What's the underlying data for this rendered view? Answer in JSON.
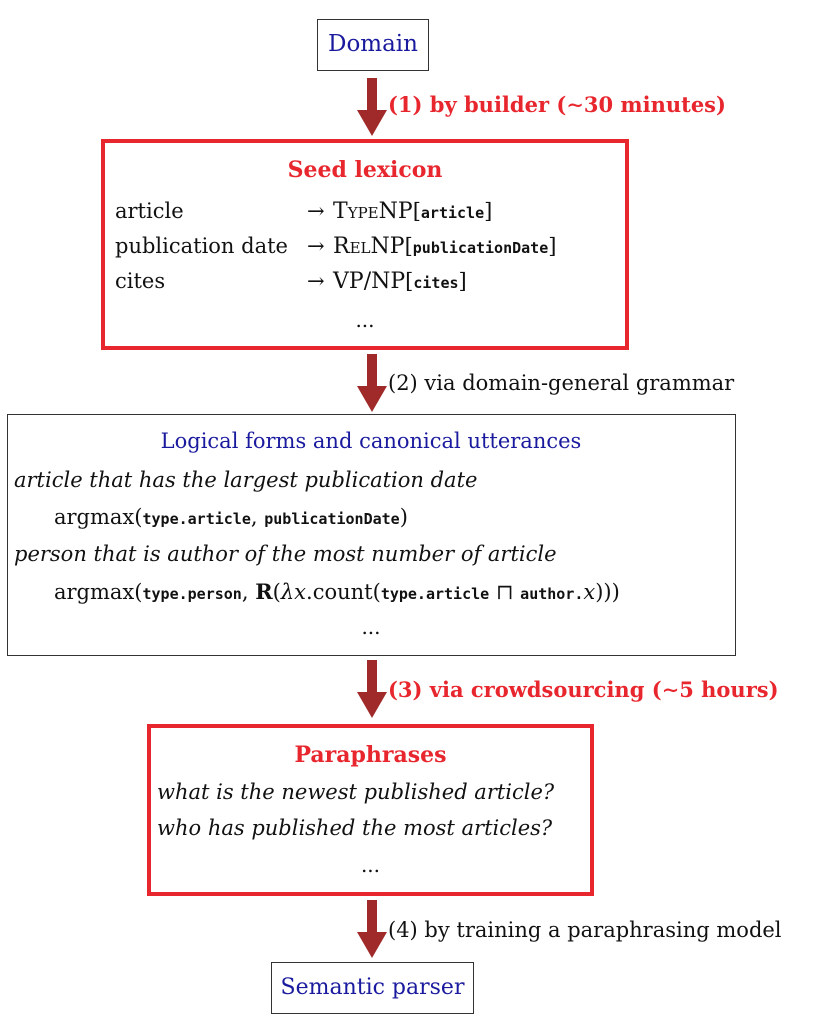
{
  "nodes": {
    "domain": {
      "label": "Domain"
    },
    "seed_lexicon": {
      "title": "Seed lexicon",
      "entries": [
        {
          "word": "article",
          "arrow": "→",
          "cat_big1": "T",
          "cat_small": "YPE",
          "cat_big2": "NP",
          "pred": "article"
        },
        {
          "word": "publication date",
          "arrow": "→",
          "cat_big1": "R",
          "cat_small": "EL",
          "cat_big2": "NP",
          "pred": "publicationDate"
        },
        {
          "word": "cites",
          "arrow": "→",
          "cat_big1": "VP/NP",
          "cat_small": "",
          "cat_big2": "",
          "pred": "cites"
        }
      ],
      "ellipsis": "..."
    },
    "logical_forms": {
      "title": "Logical forms and canonical utterances",
      "utterance1": "article that has the largest publication date",
      "lf1": {
        "fn": "argmax",
        "arg1": "type.article",
        "sep": ",",
        "arg2": "publicationDate"
      },
      "utterance2": "person that is author of the most number of article",
      "lf2": {
        "fn": "argmax",
        "arg1": "type.person",
        "sep": ",",
        "R": "R",
        "lambda": "λx",
        "count": "count",
        "inner1": "type.article",
        "meet": "⊓",
        "inner2": "author.",
        "var": "x",
        "close": ")))"
      },
      "ellipsis": "..."
    },
    "paraphrases": {
      "title": "Paraphrases",
      "items": [
        "what is the newest published article?",
        "who has published the most articles?"
      ],
      "ellipsis": "..."
    },
    "semantic_parser": {
      "label": "Semantic parser"
    }
  },
  "steps": [
    {
      "label": "(1) by builder (∼30 minutes)",
      "highlight": true
    },
    {
      "label": "(2) via domain-general grammar",
      "highlight": false
    },
    {
      "label": "(3) via crowdsourcing (∼5 hours)",
      "highlight": true
    },
    {
      "label": "(4) by training a paraphrasing model",
      "highlight": false
    }
  ],
  "colors": {
    "red": "#e8262e",
    "blue": "#1a1a9e",
    "arrow": "#a02a2a"
  }
}
